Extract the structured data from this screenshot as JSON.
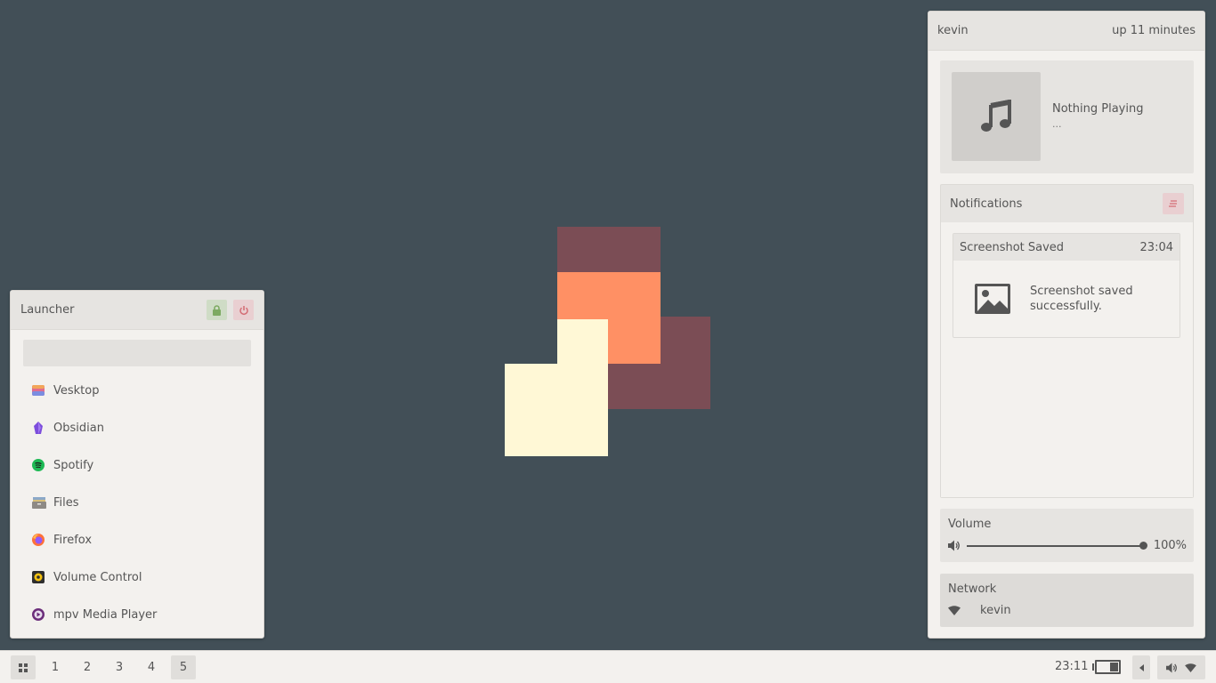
{
  "launcher": {
    "title": "Launcher",
    "search_placeholder": "",
    "apps": [
      {
        "label": "Vesktop",
        "icon": "vesktop-icon"
      },
      {
        "label": "Obsidian",
        "icon": "obsidian-icon"
      },
      {
        "label": "Spotify",
        "icon": "spotify-icon"
      },
      {
        "label": "Files",
        "icon": "files-icon"
      },
      {
        "label": "Firefox",
        "icon": "firefox-icon"
      },
      {
        "label": "Volume Control",
        "icon": "volume-control-icon"
      },
      {
        "label": "mpv Media Player",
        "icon": "mpv-icon"
      }
    ]
  },
  "panel": {
    "user": "kevin",
    "uptime": "up 11 minutes",
    "media": {
      "title": "Nothing Playing",
      "artist": "..."
    },
    "notifications": {
      "title": "Notifications",
      "items": [
        {
          "title": "Screenshot Saved",
          "time": "23:04",
          "body": "Screenshot saved successfully."
        }
      ]
    },
    "volume": {
      "title": "Volume",
      "percent_label": "100%",
      "level": 1.0
    },
    "network": {
      "title": "Network",
      "ssid": "kevin"
    }
  },
  "bar": {
    "workspaces": [
      "1",
      "2",
      "3",
      "4",
      "5"
    ],
    "active_workspace": "5",
    "clock": "23:11"
  },
  "colors": {
    "desktop": "#424f57",
    "logo_dark": "#7b4d55",
    "logo_orange": "#ff9064",
    "logo_cream": "#fff8d6",
    "lock_button": "#cfdcc6",
    "power_button": "#e9cfd1"
  }
}
